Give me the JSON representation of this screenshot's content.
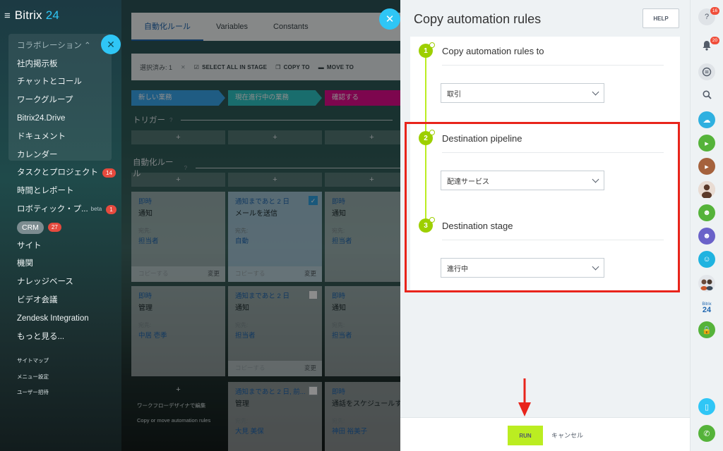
{
  "app": {
    "brand": "Bitrix",
    "brand_num": "24"
  },
  "sidebar": {
    "items": [
      {
        "label": "コラボレーション ⌃",
        "head": true
      },
      {
        "label": "社内掲示板"
      },
      {
        "label": "チャットとコール"
      },
      {
        "label": "ワークグループ"
      },
      {
        "label": "Bitrix24.Drive"
      },
      {
        "label": "ドキュメント"
      },
      {
        "label": "カレンダー"
      },
      {
        "label": "タスクとプロジェクト",
        "badge": "14"
      },
      {
        "label": "時間とレポート"
      },
      {
        "label": "ロボティック・プ...",
        "beta": "beta",
        "badge": "1"
      },
      {
        "label": "CRM",
        "pill": true,
        "badge": "27"
      },
      {
        "label": "サイト"
      },
      {
        "label": "機関"
      },
      {
        "label": "ナレッジベース"
      },
      {
        "label": "ビデオ会議"
      },
      {
        "label": "Zendesk Integration"
      },
      {
        "label": "もっと見る..."
      }
    ],
    "small_links": [
      "サイトマップ",
      "メニュー設定",
      "ユーザー招待"
    ]
  },
  "board": {
    "tabs": [
      "自動化ルール",
      "Variables",
      "Constants"
    ],
    "selected_text": "選択済み: 1",
    "toolbar": {
      "select_all": "SELECT ALL IN STAGE",
      "copy_to": "COPY TO",
      "move_to": "MOVE TO"
    },
    "stages": [
      "新しい業務",
      "現在進行中の業務",
      "確認する"
    ],
    "trigger_label": "トリガー",
    "rules_label": "自動化ルール",
    "plus": "+",
    "cards": [
      {
        "t1": "即時",
        "t2": "通知",
        "t3": "宛先:",
        "t4": "担当者",
        "copy": "コピーする",
        "edit": "変更"
      },
      {
        "t1": "通知まであと 2 日",
        "t2": "メールを送信",
        "t3": "宛先:",
        "t4": "自動",
        "copy": "コピーする",
        "edit": "変更"
      },
      {
        "t1": "即時",
        "t2": "通知",
        "t3": "宛先:",
        "t4": "担当者"
      },
      {
        "t1": "即時",
        "t2": "管理",
        "t3": "宛先:",
        "t4": "中居 壱季"
      },
      {
        "t1": "通知まであと 2 日",
        "t2": "通知",
        "t3": "宛先:",
        "t4": "担当者",
        "copy": "コピーする",
        "edit": "変更"
      },
      {
        "t1": "即時",
        "t2": "通知",
        "t3": "宛先:",
        "t4": "担当者"
      },
      {
        "t1": "通知まであと 2 日, 前...",
        "t2": "管理",
        "t3": "宛先:",
        "t4": "大見 美保"
      },
      {
        "t1": "即時",
        "t2": "通話をスケジュールす",
        "t3": "宛先:",
        "t4": "神田 裕美子"
      }
    ],
    "footer_1": "ワークフローデザイナで編集",
    "footer_2": "Copy or move automation rules"
  },
  "panel": {
    "title": "Copy automation rules",
    "help": "HELP",
    "steps": [
      {
        "num": "1",
        "label": "Copy automation rules to",
        "value": "取引"
      },
      {
        "num": "2",
        "label": "Destination pipeline",
        "value": "配達サービス"
      },
      {
        "num": "3",
        "label": "Destination stage",
        "value": "進行中"
      }
    ],
    "run": "RUN",
    "cancel": "キャンセル"
  },
  "rail": {
    "help_badge": "16",
    "bell_badge": "20",
    "bitrix_small": "Bitrix",
    "bitrix_num": "24"
  },
  "colors": {
    "accent": "#2fc6f6",
    "run": "#bbed21",
    "highlight": "#e8241b",
    "step": "#9dcf00"
  }
}
